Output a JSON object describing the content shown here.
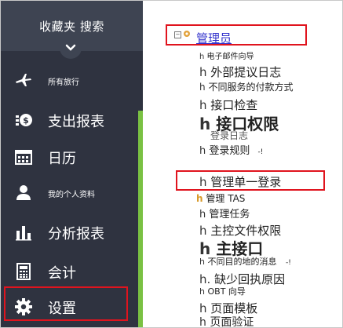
{
  "sidebar": {
    "title": "收藏夹 搜索",
    "items": [
      {
        "label": "所有旅行",
        "icon": "airplane-icon",
        "size": "small"
      },
      {
        "label": "支出报表",
        "icon": "receipt-icon",
        "size": "big"
      },
      {
        "label": "日历",
        "icon": "calendar-icon",
        "size": "big"
      },
      {
        "label": "我的个人资料",
        "icon": "person-icon",
        "size": "small"
      },
      {
        "label": "分析报表",
        "icon": "bar-chart-icon",
        "size": "big"
      },
      {
        "label": "会计",
        "icon": "calculator-icon",
        "size": "big"
      },
      {
        "label": "设置",
        "icon": "gear-icon",
        "size": "big"
      }
    ]
  },
  "tree": {
    "root": "管理员",
    "nodes": [
      {
        "prefix": "h",
        "label": "电子邮件向导"
      },
      {
        "prefix": "h",
        "label": "外部提议日志"
      },
      {
        "prefix": "h",
        "label": "不同服务的付款方式"
      },
      {
        "prefix": "h",
        "label": "接口检查"
      },
      {
        "prefix": "h",
        "label": "接口权限"
      },
      {
        "prefix": "",
        "label": "登录日志"
      },
      {
        "prefix": "h",
        "label": "登录规则",
        "suffix": "-!"
      },
      {
        "prefix": "h",
        "label": "管理单一登录"
      },
      {
        "prefix": "h",
        "label": "管理 TAS"
      },
      {
        "prefix": "h",
        "label": "管理任务"
      },
      {
        "prefix": "h",
        "label": "主控文件权限"
      },
      {
        "prefix": "h",
        "label": "主接口"
      },
      {
        "prefix": "h",
        "label": "不同目的地的消息",
        "suffix": "-!"
      },
      {
        "prefix": "h.",
        "label": "缺少回执原因"
      },
      {
        "prefix": "h",
        "label": "OBT 向导"
      },
      {
        "prefix": "h",
        "label": "页面模板"
      },
      {
        "prefix": "h",
        "label": "页面验证"
      }
    ]
  },
  "colors": {
    "sidebar_bg": "#2f3340",
    "sidebar_header_bg": "#3e4452",
    "accent_green": "#7ac143",
    "highlight_red": "#e0141e",
    "link_blue": "#3333cc"
  }
}
